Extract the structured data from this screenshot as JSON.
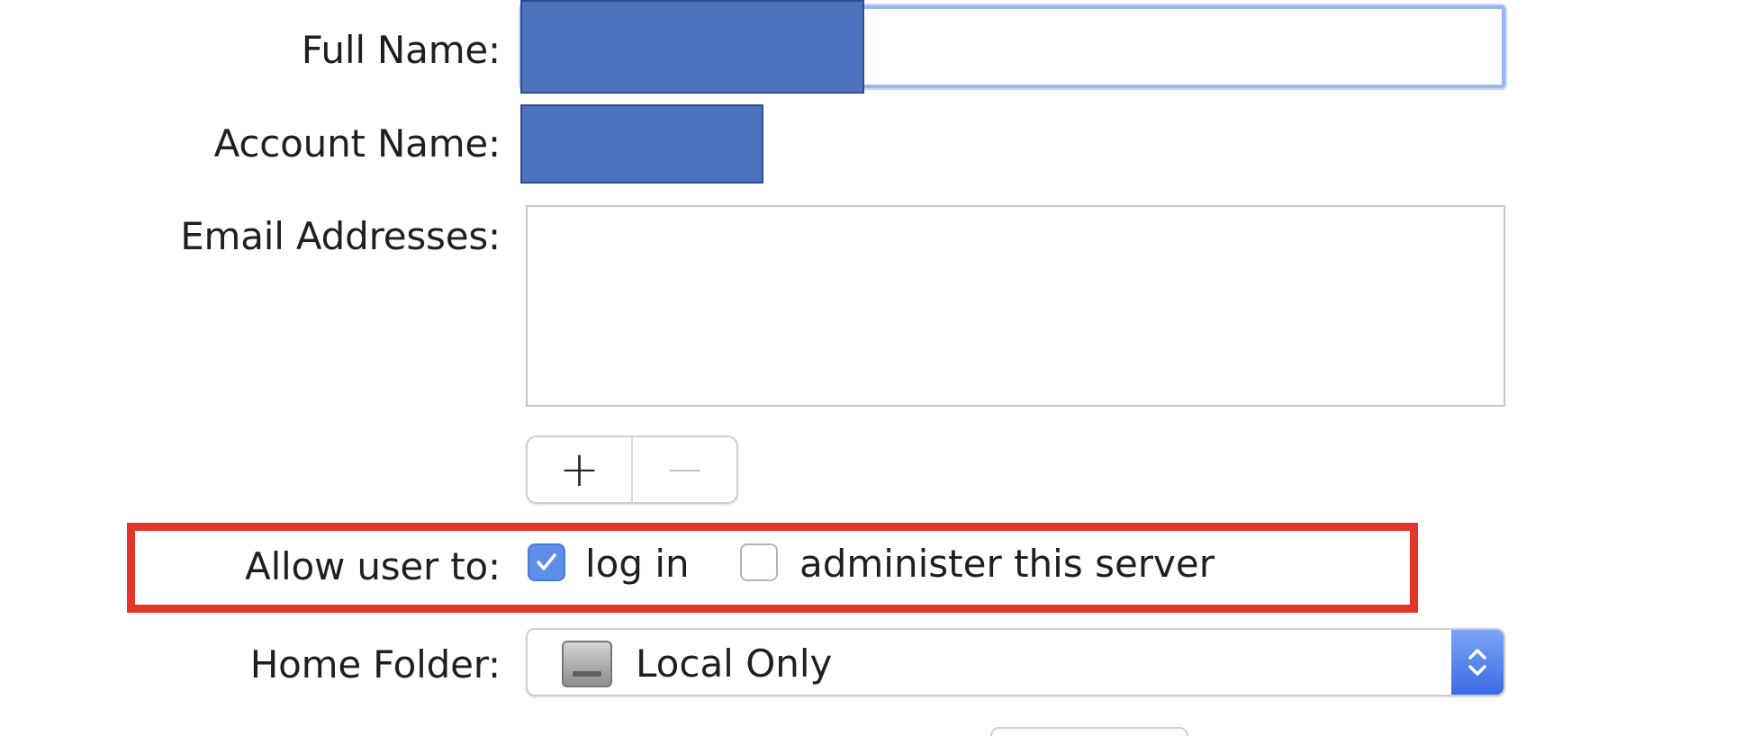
{
  "form": {
    "full_name_label": "Full Name:",
    "account_name_label": "Account Name:",
    "email_label": "Email Addresses:",
    "allow_label": "Allow user to:",
    "home_folder_label": "Home Folder:"
  },
  "email_controls": {
    "add_glyph": "+",
    "remove_glyph": "−"
  },
  "permissions": {
    "login_label": "log in",
    "login_checked": true,
    "admin_label": "administer this server",
    "admin_checked": false
  },
  "home_folder": {
    "selected": "Local Only",
    "icon": "internal-disk-icon"
  },
  "colors": {
    "highlight": "#e3352a",
    "redaction": "#4f72bf",
    "accent": "#3b6be4"
  }
}
